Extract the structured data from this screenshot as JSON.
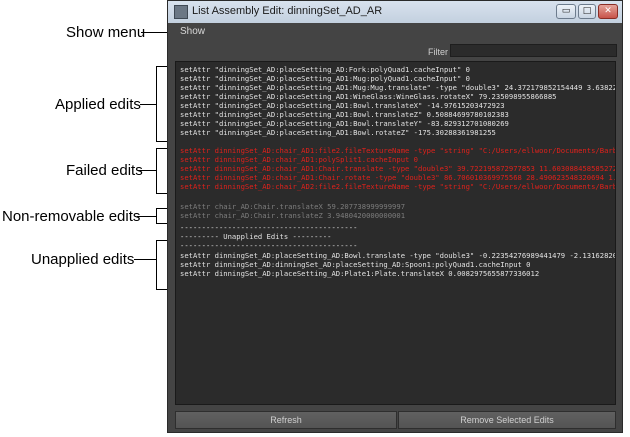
{
  "window": {
    "title": "List Assembly Edit: dinningSet_AD_AR",
    "buttons": {
      "minimize": "▭",
      "maximize": "□",
      "close": "✕"
    }
  },
  "menubar": {
    "show": "Show"
  },
  "filter": {
    "label": "Filter",
    "value": ""
  },
  "callouts": {
    "show_menu": "Show menu",
    "applied": "Applied edits",
    "failed": "Failed edits",
    "non_removable": "Non-removable  edits",
    "unapplied": "Unapplied edits"
  },
  "edits": {
    "applied": [
      "setAttr \"dinningSet_AD:placeSetting_AD:Fork:polyQuad1.cacheInput\" 0",
      "setAttr \"dinningSet_AD:placeSetting_AD1:Mug:polyQuad1.cacheInput\" 0",
      "setAttr \"dinningSet_AD:placeSetting_AD1:Mug:Mug.translate\" -type \"double3\" 24.372179852154449 3.6382254223785826 -",
      "setAttr \"dinningSet_AD:placeSetting_AD1:WineGlass:WineGlass.rotateX\" 79.235098955866885",
      "setAttr \"dinningSet_AD:placeSetting_AD1:Bowl.translateX\" -14.97615203472923",
      "setAttr \"dinningSet_AD:placeSetting_AD1:Bowl.translateZ\" 0.50884699780102383",
      "setAttr \"dinningSet_AD:placeSetting_AD1:Bowl.translateY\" -83.829312701080269",
      "setAttr \"dinningSet_AD:placeSetting_AD1:Bowl.rotateZ\" -175.30288361981255"
    ],
    "failed": [
      "setAttr dinningSet_AD:chair_AD1:file2.fileTextureName -type \"string\" \"C:/Users/ellwoor/Documents/Barbaretta/Scene Assem...",
      "setAttr dinningSet_AD:chair_AD1:polySplit1.cacheInput 0",
      "setAttr dinningSet_AD:chair_AD1:Chair.translate -type \"double3\" 39.722195872977853 11.603088458585272 -0.01219735...",
      "setAttr dinningSet_AD:chair_AD1:Chair.rotate -type \"double3\" 86.706010369975568 28.490623548320694 1.3026497665...",
      "setAttr dinningSet_AD:chair_AD2:file2.fileTextureName -type \"string\" \"C:/Users/ellwoor/Documents/Barbaretta/Scene Assem..."
    ],
    "non_removable": [
      "setAttr chair_AD:Chair.translateX 59.207738999999997",
      "setAttr chair_AD:Chair.translateZ 3.9480420000000001"
    ],
    "unapplied_separator_top": "-----------------------------------------",
    "unapplied_header": "--------- Unapplied Edits ---------",
    "unapplied_separator_bottom": "-----------------------------------------",
    "unapplied": [
      "setAttr dinningSet_AD:placeSetting_AD:Bowl.translate -type \"double3\" -0.22354276989441479 -2.1316282072803011e-01...",
      "setAttr dinningSet_AD:dinningSet_AD:placeSetting_AD:Spoon1:polyQuad1.cacheInput 0",
      "setAttr dinningSet_AD:placeSetting_AD:Plate1:Plate.translateX 0.0082975655877336012"
    ]
  },
  "buttons": {
    "refresh": "Refresh",
    "remove": "Remove Selected Edits"
  },
  "colors": {
    "failed": "#e0211b",
    "window_bg": "#444444",
    "list_bg": "#2b2b2b"
  }
}
